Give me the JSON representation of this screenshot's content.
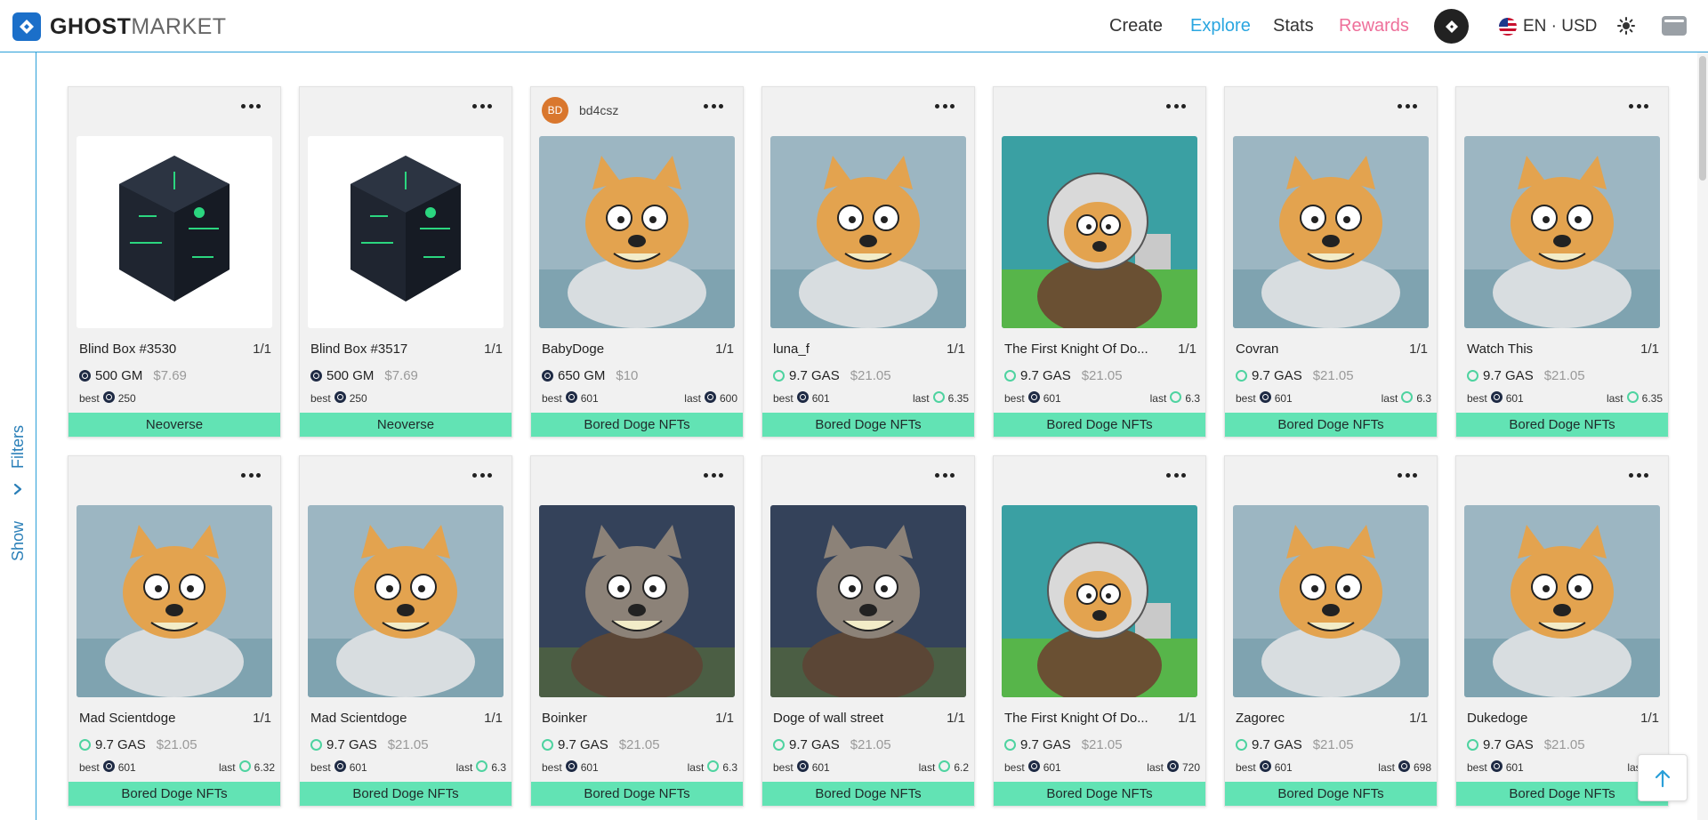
{
  "brand": {
    "bold": "GHOST",
    "light": "MARKET"
  },
  "nav": {
    "create": "Create",
    "explore": "Explore",
    "stats": "Stats",
    "rewards": "Rewards",
    "language": "EN · USD"
  },
  "sidebar": {
    "filters": "Filters",
    "show": "Show"
  },
  "colors": {
    "accent": "#2aa6e0",
    "rewards": "#ee6f9a",
    "collection_bar": "#62e3b4",
    "brand": "#1b6fc9"
  },
  "cards": [
    {
      "name": "Blind Box #3530",
      "edition": "1/1",
      "price": "500 GM",
      "usd": "$7.69",
      "currency": "gm",
      "best_label": "best",
      "best": "250",
      "best_currency": "gm",
      "last_label": "",
      "last": "",
      "last_currency": "",
      "collection": "Neoverse",
      "owner": "",
      "owner_initials": "",
      "image": "blind-box"
    },
    {
      "name": "Blind Box #3517",
      "edition": "1/1",
      "price": "500 GM",
      "usd": "$7.69",
      "currency": "gm",
      "best_label": "best",
      "best": "250",
      "best_currency": "gm",
      "last_label": "",
      "last": "",
      "last_currency": "",
      "collection": "Neoverse",
      "owner": "",
      "owner_initials": "",
      "image": "blind-box"
    },
    {
      "name": "BabyDoge",
      "edition": "1/1",
      "price": "650 GM",
      "usd": "$10",
      "currency": "gm",
      "best_label": "best",
      "best": "601",
      "best_currency": "gm",
      "last_label": "last",
      "last": "600",
      "last_currency": "gm",
      "collection": "Bored Doge NFTs",
      "owner": "bd4csz",
      "owner_initials": "BD",
      "image": "doge"
    },
    {
      "name": "luna_f",
      "edition": "1/1",
      "price": "9.7 GAS",
      "usd": "$21.05",
      "currency": "gas",
      "best_label": "best",
      "best": "601",
      "best_currency": "gm",
      "last_label": "last",
      "last": "6.35",
      "last_currency": "gas",
      "collection": "Bored Doge NFTs",
      "owner": "",
      "owner_initials": "",
      "image": "doge"
    },
    {
      "name": "The First Knight Of Do...",
      "edition": "1/1",
      "price": "9.7 GAS",
      "usd": "$21.05",
      "currency": "gas",
      "best_label": "best",
      "best": "601",
      "best_currency": "gm",
      "last_label": "last",
      "last": "6.3",
      "last_currency": "gas",
      "collection": "Bored Doge NFTs",
      "owner": "",
      "owner_initials": "",
      "image": "knight"
    },
    {
      "name": "Covran",
      "edition": "1/1",
      "price": "9.7 GAS",
      "usd": "$21.05",
      "currency": "gas",
      "best_label": "best",
      "best": "601",
      "best_currency": "gm",
      "last_label": "last",
      "last": "6.3",
      "last_currency": "gas",
      "collection": "Bored Doge NFTs",
      "owner": "",
      "owner_initials": "",
      "image": "doge"
    },
    {
      "name": "Watch This",
      "edition": "1/1",
      "price": "9.7 GAS",
      "usd": "$21.05",
      "currency": "gas",
      "best_label": "best",
      "best": "601",
      "best_currency": "gm",
      "last_label": "last",
      "last": "6.35",
      "last_currency": "gas",
      "collection": "Bored Doge NFTs",
      "owner": "",
      "owner_initials": "",
      "image": "doge"
    },
    {
      "name": "Mad Scientdoge",
      "edition": "1/1",
      "price": "9.7 GAS",
      "usd": "$21.05",
      "currency": "gas",
      "best_label": "best",
      "best": "601",
      "best_currency": "gm",
      "last_label": "last",
      "last": "6.32",
      "last_currency": "gas",
      "collection": "Bored Doge NFTs",
      "owner": "",
      "owner_initials": "",
      "image": "doge"
    },
    {
      "name": "Mad Scientdoge",
      "edition": "1/1",
      "price": "9.7 GAS",
      "usd": "$21.05",
      "currency": "gas",
      "best_label": "best",
      "best": "601",
      "best_currency": "gm",
      "last_label": "last",
      "last": "6.3",
      "last_currency": "gas",
      "collection": "Bored Doge NFTs",
      "owner": "",
      "owner_initials": "",
      "image": "doge"
    },
    {
      "name": "Boinker",
      "edition": "1/1",
      "price": "9.7 GAS",
      "usd": "$21.05",
      "currency": "gas",
      "best_label": "best",
      "best": "601",
      "best_currency": "gm",
      "last_label": "last",
      "last": "6.3",
      "last_currency": "gas",
      "collection": "Bored Doge NFTs",
      "owner": "",
      "owner_initials": "",
      "image": "doge-dark"
    },
    {
      "name": "Doge of wall street",
      "edition": "1/1",
      "price": "9.7 GAS",
      "usd": "$21.05",
      "currency": "gas",
      "best_label": "best",
      "best": "601",
      "best_currency": "gm",
      "last_label": "last",
      "last": "6.2",
      "last_currency": "gas",
      "collection": "Bored Doge NFTs",
      "owner": "",
      "owner_initials": "",
      "image": "doge-dark"
    },
    {
      "name": "The First Knight Of Do...",
      "edition": "1/1",
      "price": "9.7 GAS",
      "usd": "$21.05",
      "currency": "gas",
      "best_label": "best",
      "best": "601",
      "best_currency": "gm",
      "last_label": "last",
      "last": "720",
      "last_currency": "gm",
      "collection": "Bored Doge NFTs",
      "owner": "",
      "owner_initials": "",
      "image": "knight"
    },
    {
      "name": "Zagorec",
      "edition": "1/1",
      "price": "9.7 GAS",
      "usd": "$21.05",
      "currency": "gas",
      "best_label": "best",
      "best": "601",
      "best_currency": "gm",
      "last_label": "last",
      "last": "698",
      "last_currency": "gm",
      "collection": "Bored Doge NFTs",
      "owner": "",
      "owner_initials": "",
      "image": "doge"
    },
    {
      "name": "Dukedoge",
      "edition": "1/1",
      "price": "9.7 GAS",
      "usd": "$21.05",
      "currency": "gas",
      "best_label": "best",
      "best": "601",
      "best_currency": "gm",
      "last_label": "last",
      "last": "",
      "last_currency": "gm",
      "collection": "Bored Doge NFTs",
      "owner": "",
      "owner_initials": "",
      "image": "doge"
    }
  ]
}
